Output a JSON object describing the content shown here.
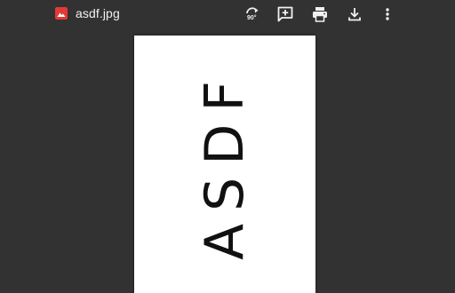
{
  "toolbar": {
    "file_icon": "image-file-icon",
    "file_icon_color": "#e53935",
    "file_name": "asdf.jpg",
    "rotate_label": "90°",
    "icons": [
      "rotate-clockwise-icon",
      "add-comment-icon",
      "print-icon",
      "download-icon",
      "more-vert-icon"
    ]
  },
  "colors": {
    "background": "#323232",
    "toolbar_text": "#f1f1f1",
    "page": "#ffffff"
  },
  "document": {
    "text": "ASDF",
    "text_orientation": "rotated-90-counterclockwise"
  }
}
